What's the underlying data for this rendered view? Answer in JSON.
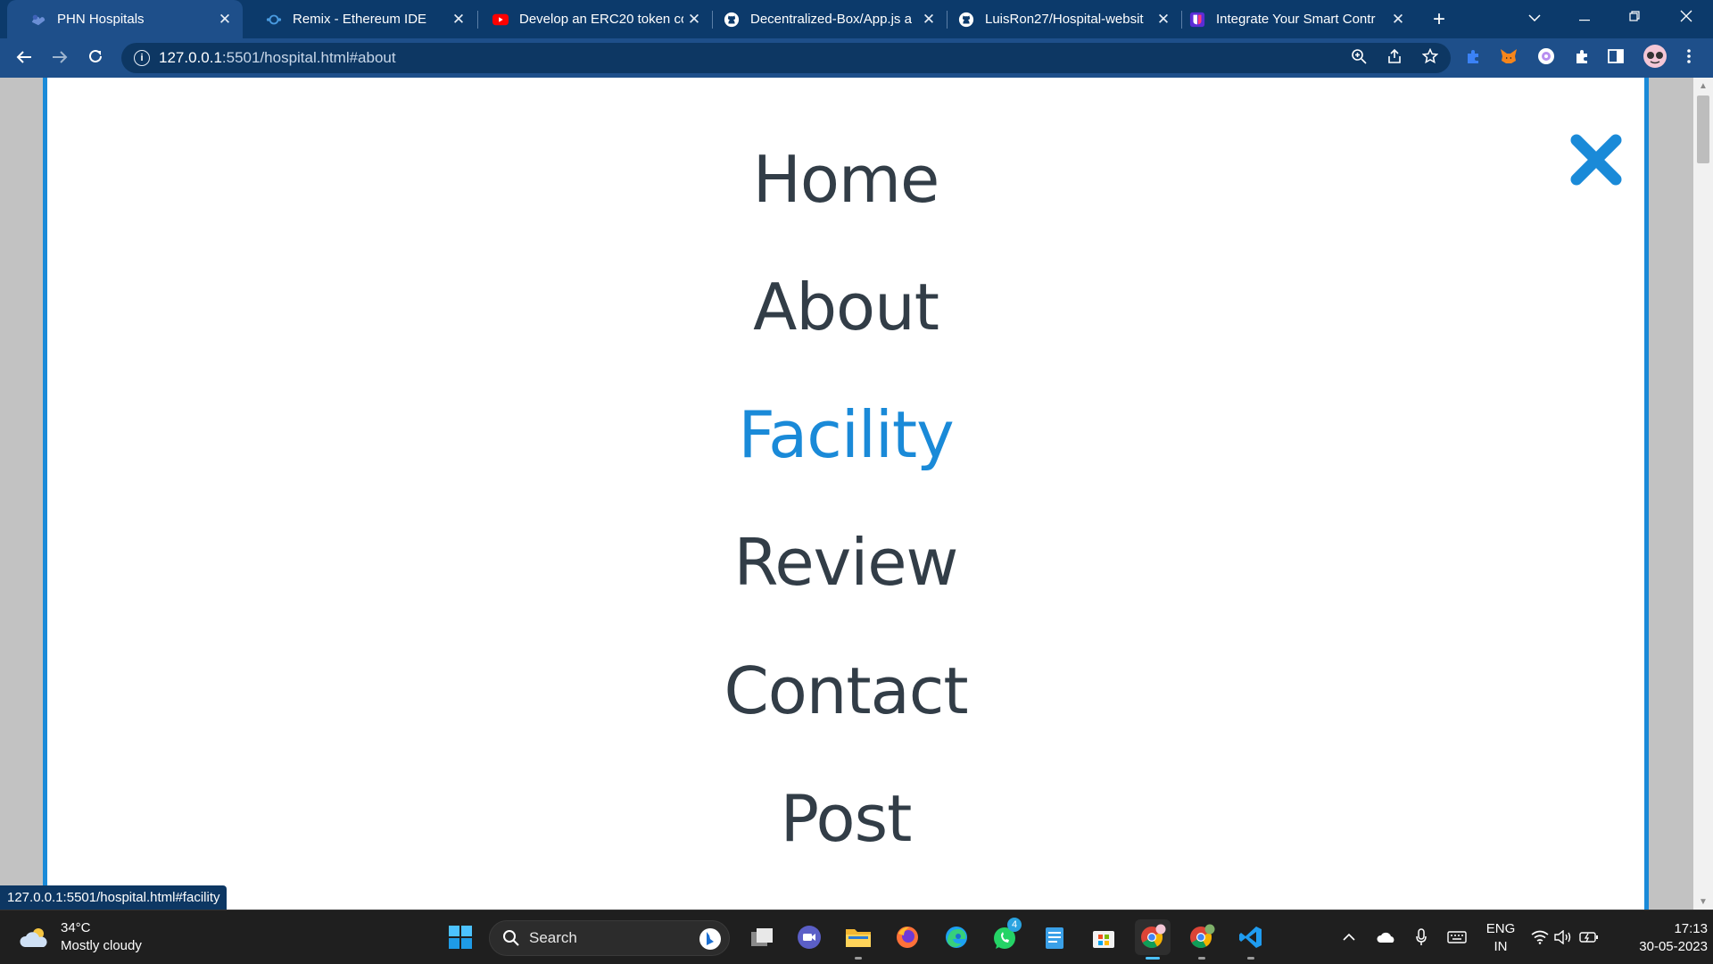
{
  "browser": {
    "tabs": [
      {
        "title": "PHN Hospitals",
        "favicon": "hospital-logo-icon",
        "active": true
      },
      {
        "title": "Remix - Ethereum IDE",
        "favicon": "remix-icon",
        "active": false
      },
      {
        "title": "Develop an ERC20 token co",
        "favicon": "youtube-icon",
        "active": false
      },
      {
        "title": "Decentralized-Box/App.js a",
        "favicon": "github-icon",
        "active": false
      },
      {
        "title": "LuisRon27/Hospital-websit",
        "favicon": "github-icon",
        "active": false
      },
      {
        "title": "Integrate Your Smart Contr",
        "favicon": "ud-icon",
        "active": false
      }
    ],
    "new_tab_symbol": "+",
    "url": {
      "host": "127.0.0.1",
      "rest": ":5501/hospital.html#about"
    },
    "status_url": "127.0.0.1:5501/hospital.html#facility"
  },
  "page": {
    "nav_items": [
      {
        "label": "Home",
        "active": false
      },
      {
        "label": "About",
        "active": false
      },
      {
        "label": "Facility",
        "active": true
      },
      {
        "label": "Review",
        "active": false
      },
      {
        "label": "Contact",
        "active": false
      },
      {
        "label": "Post",
        "active": false
      }
    ],
    "accent_color": "#1a8ad8",
    "text_color": "#323d47"
  },
  "taskbar": {
    "weather": {
      "temp": "34°C",
      "condition": "Mostly cloudy"
    },
    "search_placeholder": "Search",
    "whatsapp_badge": "4",
    "lang": {
      "line1": "ENG",
      "line2": "IN"
    },
    "clock": {
      "time": "17:13",
      "date": "30-05-2023"
    }
  }
}
